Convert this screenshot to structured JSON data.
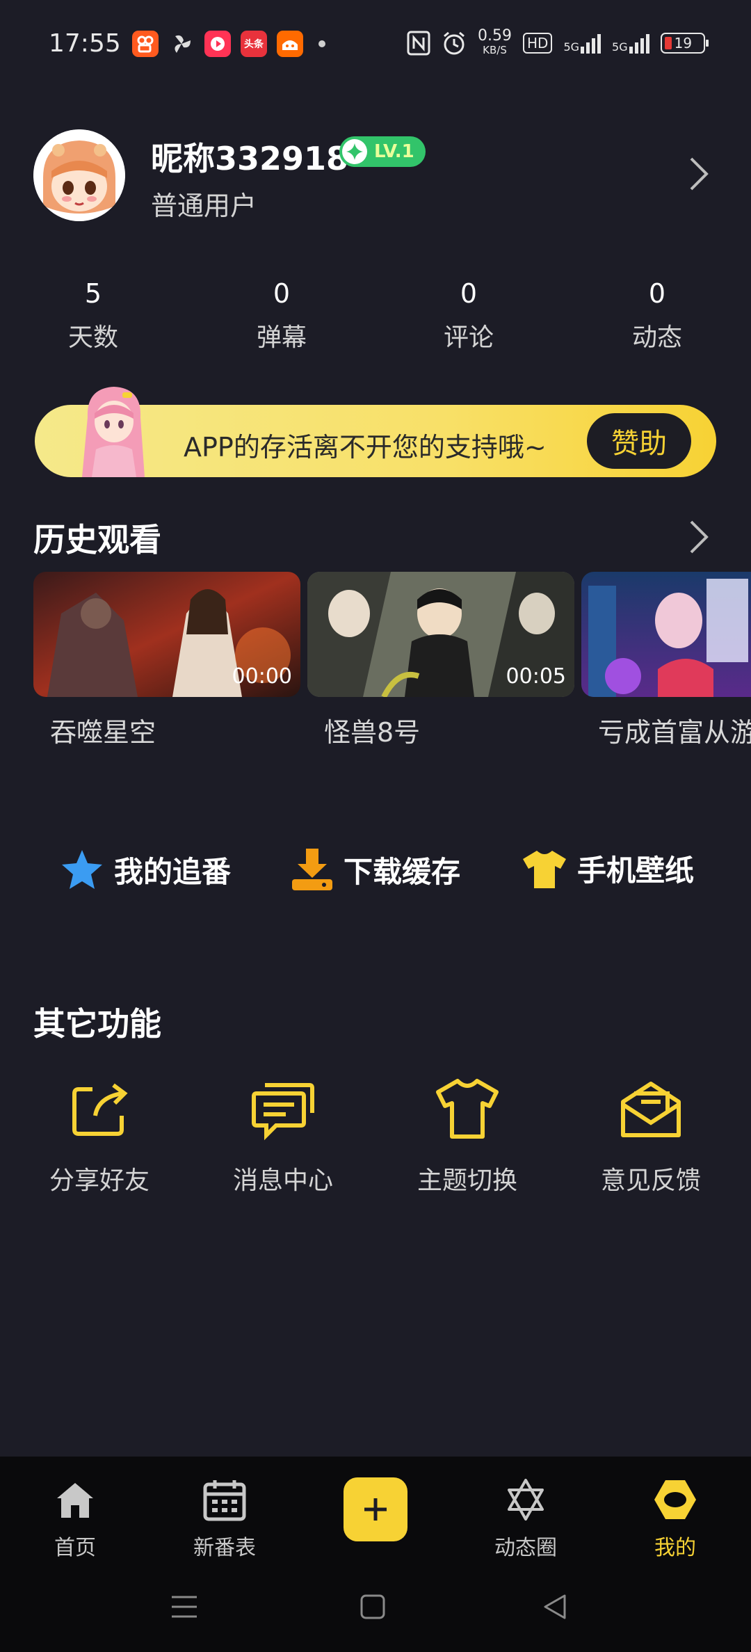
{
  "status_bar": {
    "time": "17:55",
    "net_speed_value": "0.59",
    "net_speed_unit": "KB/S",
    "hd_label": "HD",
    "sim1_label": "5G",
    "sim2_label": "5G",
    "battery": "19",
    "notification_icons": [
      "kuaishou-icon",
      "pinwheel-icon",
      "video-app-icon",
      "toutiao-icon",
      "taobao-icon"
    ]
  },
  "profile": {
    "nickname": "昵称332918",
    "level": "LV.1",
    "user_type": "普通用户"
  },
  "stats": [
    {
      "value": "5",
      "label": "天数"
    },
    {
      "value": "0",
      "label": "弹幕"
    },
    {
      "value": "0",
      "label": "评论"
    },
    {
      "value": "0",
      "label": "动态"
    }
  ],
  "banner": {
    "text": "APP的存活离不开您的支持哦~",
    "button": "赞助"
  },
  "history": {
    "title": "历史观看",
    "items": [
      {
        "title": "吞噬星空",
        "duration": "00:00"
      },
      {
        "title": "怪兽8号",
        "duration": "00:05"
      },
      {
        "title": "亏成首富从游",
        "duration": ""
      }
    ]
  },
  "quick_actions": [
    {
      "label": "我的追番",
      "icon": "star-icon",
      "color": "#3b9cf2"
    },
    {
      "label": "下载缓存",
      "icon": "download-icon",
      "color": "#f39c12"
    },
    {
      "label": "手机壁纸",
      "icon": "tshirt-icon",
      "color": "#f7d234"
    }
  ],
  "other_functions": {
    "title": "其它功能",
    "items": [
      {
        "label": "分享好友",
        "icon": "share-icon"
      },
      {
        "label": "消息中心",
        "icon": "message-icon"
      },
      {
        "label": "主题切换",
        "icon": "theme-shirt-icon"
      },
      {
        "label": "意见反馈",
        "icon": "feedback-mail-icon"
      }
    ]
  },
  "bottom_nav": {
    "items": [
      {
        "label": "首页",
        "icon": "home-icon"
      },
      {
        "label": "新番表",
        "icon": "calendar-icon"
      },
      {
        "label": "动态圈",
        "icon": "hexagram-icon"
      },
      {
        "label": "我的",
        "icon": "profile-hexagon-icon"
      }
    ],
    "active": "我的"
  },
  "colors": {
    "background": "#1c1c26",
    "accent": "#f7d234",
    "level_badge": "#32c46a"
  }
}
